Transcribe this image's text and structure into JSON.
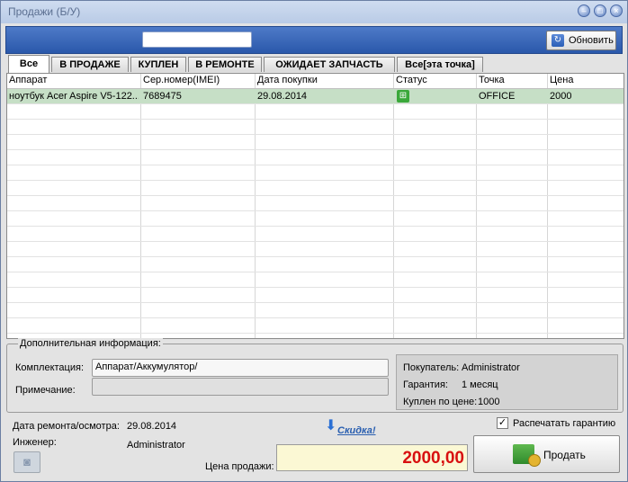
{
  "window": {
    "title": "Продажи (Б/У)"
  },
  "toolbar": {
    "search_value": "",
    "refresh_label": "Обновить"
  },
  "tabs": [
    {
      "label": "Все",
      "active": true
    },
    {
      "label": "В ПРОДАЖЕ"
    },
    {
      "label": "КУПЛЕН"
    },
    {
      "label": "В РЕМОНТЕ"
    },
    {
      "label": "ОЖИДАЕТ ЗАПЧАСТЬ"
    },
    {
      "label": "Все[эта точка]"
    }
  ],
  "grid": {
    "columns": [
      "Аппарат",
      "Сер.номер(IMEI)",
      "Дата покупки",
      "Статус",
      "Точка",
      "Цена"
    ],
    "rows": [
      {
        "device": "ноутбук Acer Aspire V5-122...",
        "serial": "7689475",
        "date": "29.08.2014",
        "status_icon": "cart-icon",
        "point": "OFFICE",
        "price": "2000"
      }
    ]
  },
  "info": {
    "legend": "Дополнительная информация:",
    "kit_label": "Комплектация:",
    "kit_value": "Аппарат/Аккумулятор/",
    "note_label": "Примечание:",
    "note_value": "",
    "buyer_label": "Покупатель:",
    "buyer_value": "Administrator",
    "warranty_label": "Гарантия:",
    "warranty_value": "1 месяц",
    "bought_label": "Куплен по цене:",
    "bought_value": "1000"
  },
  "bottom": {
    "repair_date_label": "Дата ремонта/осмотра:",
    "repair_date_value": "29.08.2014",
    "engineer_label": "Инженер:",
    "engineer_value": "Administrator",
    "discount_label": "Скидка!",
    "print_warranty_label": "Распечатать гарантию",
    "print_warranty_checked": true,
    "price_label": "Цена продажи:",
    "price_value": "2000,00",
    "sell_label": "Продать"
  }
}
